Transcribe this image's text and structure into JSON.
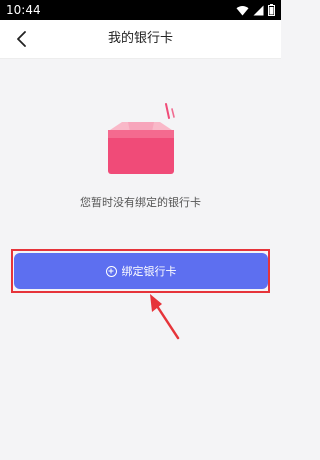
{
  "status_bar": {
    "time": "10:44"
  },
  "header": {
    "title": "我的银行卡"
  },
  "empty_state": {
    "message": "您暂时没有绑定的银行卡"
  },
  "bind_button": {
    "label": "绑定银行卡"
  },
  "colors": {
    "button": "#5d6ff0",
    "highlight": "#e6343a",
    "card_pink": "#f04b78"
  }
}
